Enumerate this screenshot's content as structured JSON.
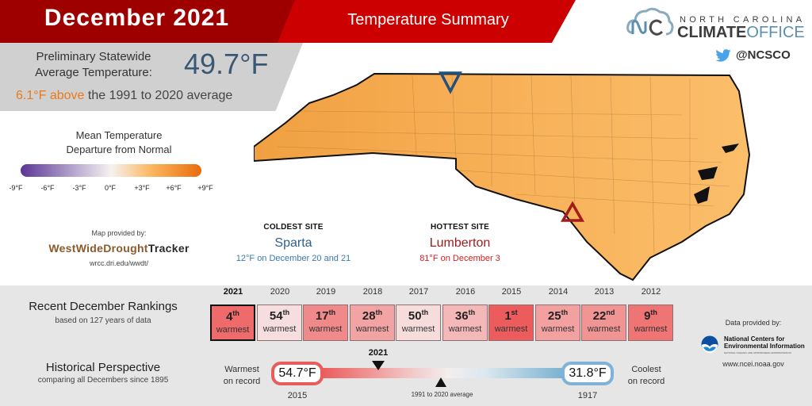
{
  "header": {
    "title": "December 2021",
    "subtitle": "Temperature Summary"
  },
  "statewide": {
    "label_line1": "Preliminary Statewide",
    "label_line2": "Average Temperature:",
    "value": "49.7°F",
    "departure_highlight": "6.1°F above",
    "departure_rest": " the 1991 to 2020 average"
  },
  "legend": {
    "title_line1": "Mean Temperature",
    "title_line2": "Departure from Normal",
    "ticks": [
      "-9°F",
      "-6°F",
      "-3°F",
      "0°F",
      "+3°F",
      "+6°F",
      "+9°F"
    ],
    "colors": {
      "cold": "#5c3596",
      "neutral": "#f5f2f0",
      "warm": "#e86c0c"
    }
  },
  "map_credit": {
    "label": "Map provided by:",
    "logo_part1": "WestWideDrought",
    "logo_part2": "Tracker",
    "url": "wrcc.dri.edu/wwdt/"
  },
  "brand": {
    "line1": "NORTH CAROLINA",
    "line2_bold": "CLIMATE",
    "line2_light": "OFFICE",
    "twitter": "@NCSCO"
  },
  "sites": {
    "coldest": {
      "heading": "COLDEST SITE",
      "name": "Sparta",
      "detail": "12°F on December 20 and 21",
      "color": "#2f5f8f"
    },
    "hottest": {
      "heading": "HOTTEST SITE",
      "name": "Lumberton",
      "detail": "81°F on December 3",
      "color": "#b22222"
    }
  },
  "rankings": {
    "title": "Recent December Rankings",
    "subtitle": "based on 127 years of data",
    "items": [
      {
        "year": "2021",
        "rank": "4",
        "suffix": "th",
        "label": "warmest",
        "color": "#ef6a6a",
        "selected": true
      },
      {
        "year": "2020",
        "rank": "54",
        "suffix": "th",
        "label": "warmest",
        "color": "#f7dede",
        "selected": false
      },
      {
        "year": "2019",
        "rank": "17",
        "suffix": "th",
        "label": "warmest",
        "color": "#f08a8a",
        "selected": false
      },
      {
        "year": "2018",
        "rank": "28",
        "suffix": "th",
        "label": "warmest",
        "color": "#f2a4a4",
        "selected": false
      },
      {
        "year": "2017",
        "rank": "50",
        "suffix": "th",
        "label": "warmest",
        "color": "#f7dcdc",
        "selected": false
      },
      {
        "year": "2016",
        "rank": "36",
        "suffix": "th",
        "label": "warmest",
        "color": "#f4b8b8",
        "selected": false
      },
      {
        "year": "2015",
        "rank": "1",
        "suffix": "st",
        "label": "warmest",
        "color": "#ec5c5c",
        "selected": false
      },
      {
        "year": "2014",
        "rank": "25",
        "suffix": "th",
        "label": "warmest",
        "color": "#f2a0a0",
        "selected": false
      },
      {
        "year": "2013",
        "rank": "22",
        "suffix": "nd",
        "label": "warmest",
        "color": "#f19494",
        "selected": false
      },
      {
        "year": "2012",
        "rank": "9",
        "suffix": "th",
        "label": "warmest",
        "color": "#ef7474",
        "selected": false
      }
    ]
  },
  "historical": {
    "title": "Historical Perspective",
    "subtitle": "comparing all Decembers since 1895",
    "warmest_label_1": "Warmest",
    "warmest_label_2": "on record",
    "warmest_value": "54.7°F",
    "warmest_year": "2015",
    "coolest_label_1": "Coolest",
    "coolest_label_2": "on record",
    "coolest_value": "31.8°F",
    "coolest_year": "1917",
    "current_marker_label": "2021",
    "average_marker_label": "1991 to 2020 average"
  },
  "data_credit": {
    "label": "Data provided by:",
    "org_line1": "National Centers for",
    "org_line2": "Environmental Information",
    "org_sub": "NATIONAL OCEANIC AND ATMOSPHERIC ADMINISTRATION",
    "url": "www.ncei.noaa.gov"
  }
}
